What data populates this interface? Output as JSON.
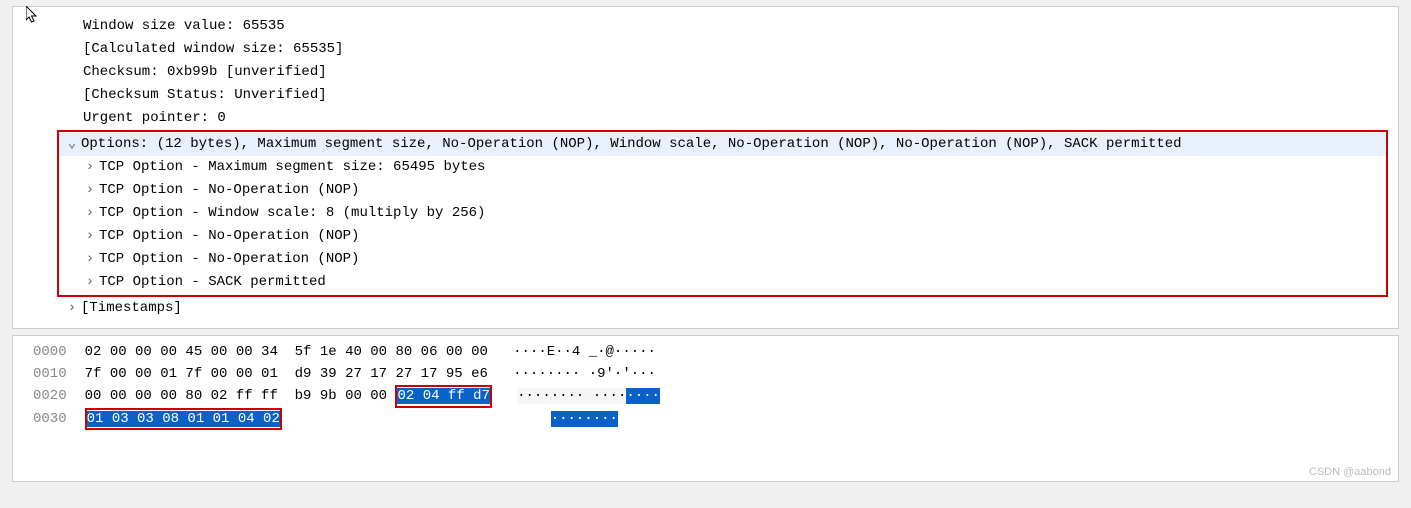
{
  "details": {
    "win_size": "Window size value: 65535",
    "calc_win": "[Calculated window size: 65535]",
    "checksum": "Checksum: 0xb99b [unverified]",
    "chk_status": "[Checksum Status: Unverified]",
    "urgent": "Urgent pointer: 0",
    "options_header": "Options: (12 bytes), Maximum segment size, No-Operation (NOP), Window scale, No-Operation (NOP), No-Operation (NOP), SACK permitted",
    "opt_mss": "TCP Option - Maximum segment size: 65495 bytes",
    "opt_nop1": "TCP Option - No-Operation (NOP)",
    "opt_wscale": "TCP Option - Window scale: 8 (multiply by 256)",
    "opt_nop2": "TCP Option - No-Operation (NOP)",
    "opt_nop3": "TCP Option - No-Operation (NOP)",
    "opt_sack": "TCP Option - SACK permitted",
    "timestamps": "[Timestamps]"
  },
  "hex": {
    "r0": {
      "off": "0000",
      "b1": "02 00 00 00 45 00 00 34",
      "b2": "5f 1e 40 00 80 06 00 00",
      "a": "····E··4 _·@·····"
    },
    "r1": {
      "off": "0010",
      "b1": "7f 00 00 01 7f 00 00 01",
      "b2": "d9 39 27 17 27 17 95 e6",
      "a": "········ ·9'·'···"
    },
    "r2": {
      "off": "0020",
      "b1": "00 00 00 00 80 02 ff ff",
      "b2a": "b9 9b 00 00 ",
      "b2sel": "02 04 ff d7",
      "a_plain_pre": "········ ····",
      "a_sel": "····"
    },
    "r3": {
      "off": "0030",
      "sel": "01 03 03 08 01 01 04 02",
      "a_sel": "········"
    }
  },
  "watermark": "CSDN @aabond",
  "glyphs": {
    "expanded": "⌄",
    "collapsed": "›"
  }
}
